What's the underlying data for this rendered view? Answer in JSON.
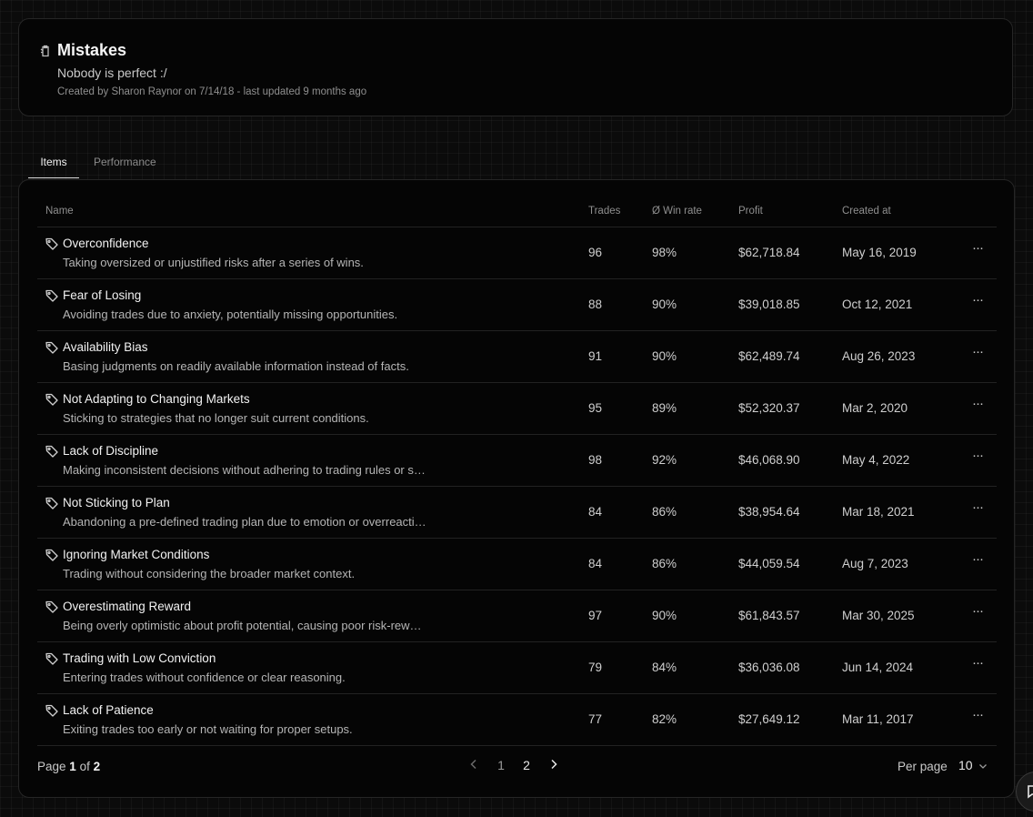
{
  "header": {
    "title": "Mistakes",
    "subtitle": "Nobody is perfect :/",
    "meta": "Created by Sharon Raynor on 7/14/18 - last updated 9 months ago"
  },
  "tabs": [
    {
      "label": "Items",
      "active": true
    },
    {
      "label": "Performance",
      "active": false
    }
  ],
  "table": {
    "columns": {
      "name": "Name",
      "trades": "Trades",
      "win_rate": "Ø Win rate",
      "profit": "Profit",
      "created": "Created at"
    },
    "rows": [
      {
        "name": "Overconfidence",
        "desc": "Taking oversized or unjustified risks after a series of wins.",
        "trades": "96",
        "win": "98%",
        "profit": "$62,718.84",
        "created": "May 16, 2019"
      },
      {
        "name": "Fear of Losing",
        "desc": "Avoiding trades due to anxiety, potentially missing opportunities.",
        "trades": "88",
        "win": "90%",
        "profit": "$39,018.85",
        "created": "Oct 12, 2021"
      },
      {
        "name": "Availability Bias",
        "desc": "Basing judgments on readily available information instead of facts.",
        "trades": "91",
        "win": "90%",
        "profit": "$62,489.74",
        "created": "Aug 26, 2023"
      },
      {
        "name": "Not Adapting to Changing Markets",
        "desc": "Sticking to strategies that no longer suit current conditions.",
        "trades": "95",
        "win": "89%",
        "profit": "$52,320.37",
        "created": "Mar 2, 2020"
      },
      {
        "name": "Lack of Discipline",
        "desc": "Making inconsistent decisions without adhering to trading rules or s…",
        "trades": "98",
        "win": "92%",
        "profit": "$46,068.90",
        "created": "May 4, 2022"
      },
      {
        "name": "Not Sticking to Plan",
        "desc": "Abandoning a pre-defined trading plan due to emotion or overreacti…",
        "trades": "84",
        "win": "86%",
        "profit": "$38,954.64",
        "created": "Mar 18, 2021"
      },
      {
        "name": "Ignoring Market Conditions",
        "desc": "Trading without considering the broader market context.",
        "trades": "84",
        "win": "86%",
        "profit": "$44,059.54",
        "created": "Aug 7, 2023"
      },
      {
        "name": "Overestimating Reward",
        "desc": "Being overly optimistic about profit potential, causing poor risk-rew…",
        "trades": "97",
        "win": "90%",
        "profit": "$61,843.57",
        "created": "Mar 30, 2025"
      },
      {
        "name": "Trading with Low Conviction",
        "desc": "Entering trades without confidence or clear reasoning.",
        "trades": "79",
        "win": "84%",
        "profit": "$36,036.08",
        "created": "Jun 14, 2024"
      },
      {
        "name": "Lack of Patience",
        "desc": "Exiting trades too early or not waiting for proper setups.",
        "trades": "77",
        "win": "82%",
        "profit": "$27,649.12",
        "created": "Mar 11, 2017"
      }
    ],
    "more_label": "···"
  },
  "pagination": {
    "page_word": "Page",
    "current": "1",
    "of_word": "of",
    "total": "2",
    "pages": [
      "1",
      "2"
    ],
    "prev_icon": "chevron-left-icon",
    "next_icon": "chevron-right-icon",
    "per_page_label": "Per page",
    "per_page_value": "10"
  },
  "icons": {
    "header": "clipboard-icon",
    "row": "tag-icon",
    "chat": "chat-icon"
  },
  "colors": {
    "background": "#0b0b0b",
    "card": "#050505",
    "border": "#262626",
    "text_primary": "#f2f2f2",
    "text_muted": "#8f8f8f"
  }
}
